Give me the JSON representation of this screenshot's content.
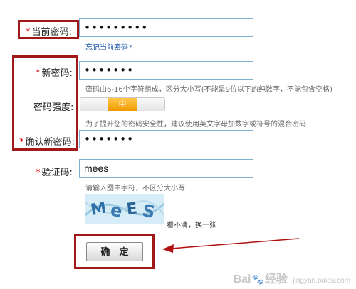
{
  "form": {
    "current_password": {
      "required_mark": "*",
      "label": "当前密码:",
      "value": "•••••••••",
      "forgot_link": "忘记当前密码?"
    },
    "new_password": {
      "required_mark": "*",
      "label": "新密码:",
      "value": "•••••••",
      "hint": "密码由6-16个字符组成，区分大小写(不能是9位以下的纯数字，不能包含空格)"
    },
    "strength": {
      "label": "密码强度:",
      "level_text": "中",
      "hint": "为了提升您的密码安全性，建议使用英文字母加数字或符号的混合密码"
    },
    "confirm_password": {
      "required_mark": "*",
      "label": "确认新密码:",
      "value": "•••••••"
    },
    "captcha": {
      "required_mark": "*",
      "label": "验证码:",
      "value": "mees",
      "hint": "请输入图中字符，不区分大小写",
      "image_text": "mees",
      "refresh_link": "看不清，换一张"
    },
    "submit_label": "确　定"
  },
  "annotation": {
    "highlight_color": "#a11818",
    "arrow_color": "#b01010"
  },
  "watermark": {
    "text_left": "Bai",
    "text_right": "经验",
    "sub": "jingyan.baidu.com"
  }
}
